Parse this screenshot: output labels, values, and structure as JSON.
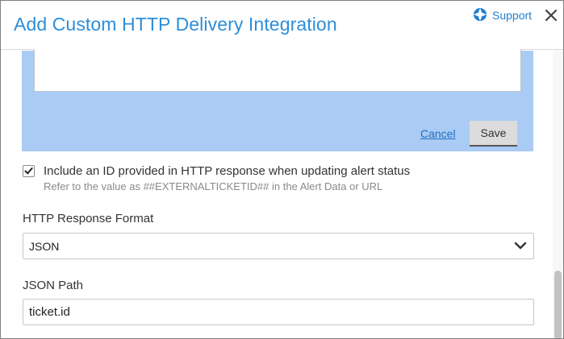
{
  "dialog": {
    "title": "Add Custom HTTP Delivery Integration",
    "support_label": "Support",
    "accent_color": "#2d8ed8"
  },
  "editor_panel": {
    "background_color": "#aacbf4",
    "textarea_value": "",
    "cancel_label": "Cancel",
    "save_label": "Save"
  },
  "include_id": {
    "checked": true,
    "label": "Include an ID provided in HTTP response when updating alert status",
    "hint": "Refer to the value as ##EXTERNALTICKETID## in the Alert Data or URL"
  },
  "response_format": {
    "label": "HTTP Response Format",
    "selected": "JSON"
  },
  "json_path": {
    "label": "JSON Path",
    "value": "ticket.id"
  },
  "icons": {
    "support": "lifebuoy-icon",
    "close": "close-icon",
    "checkbox": "checkmark-icon",
    "select": "chevron-down-icon"
  }
}
